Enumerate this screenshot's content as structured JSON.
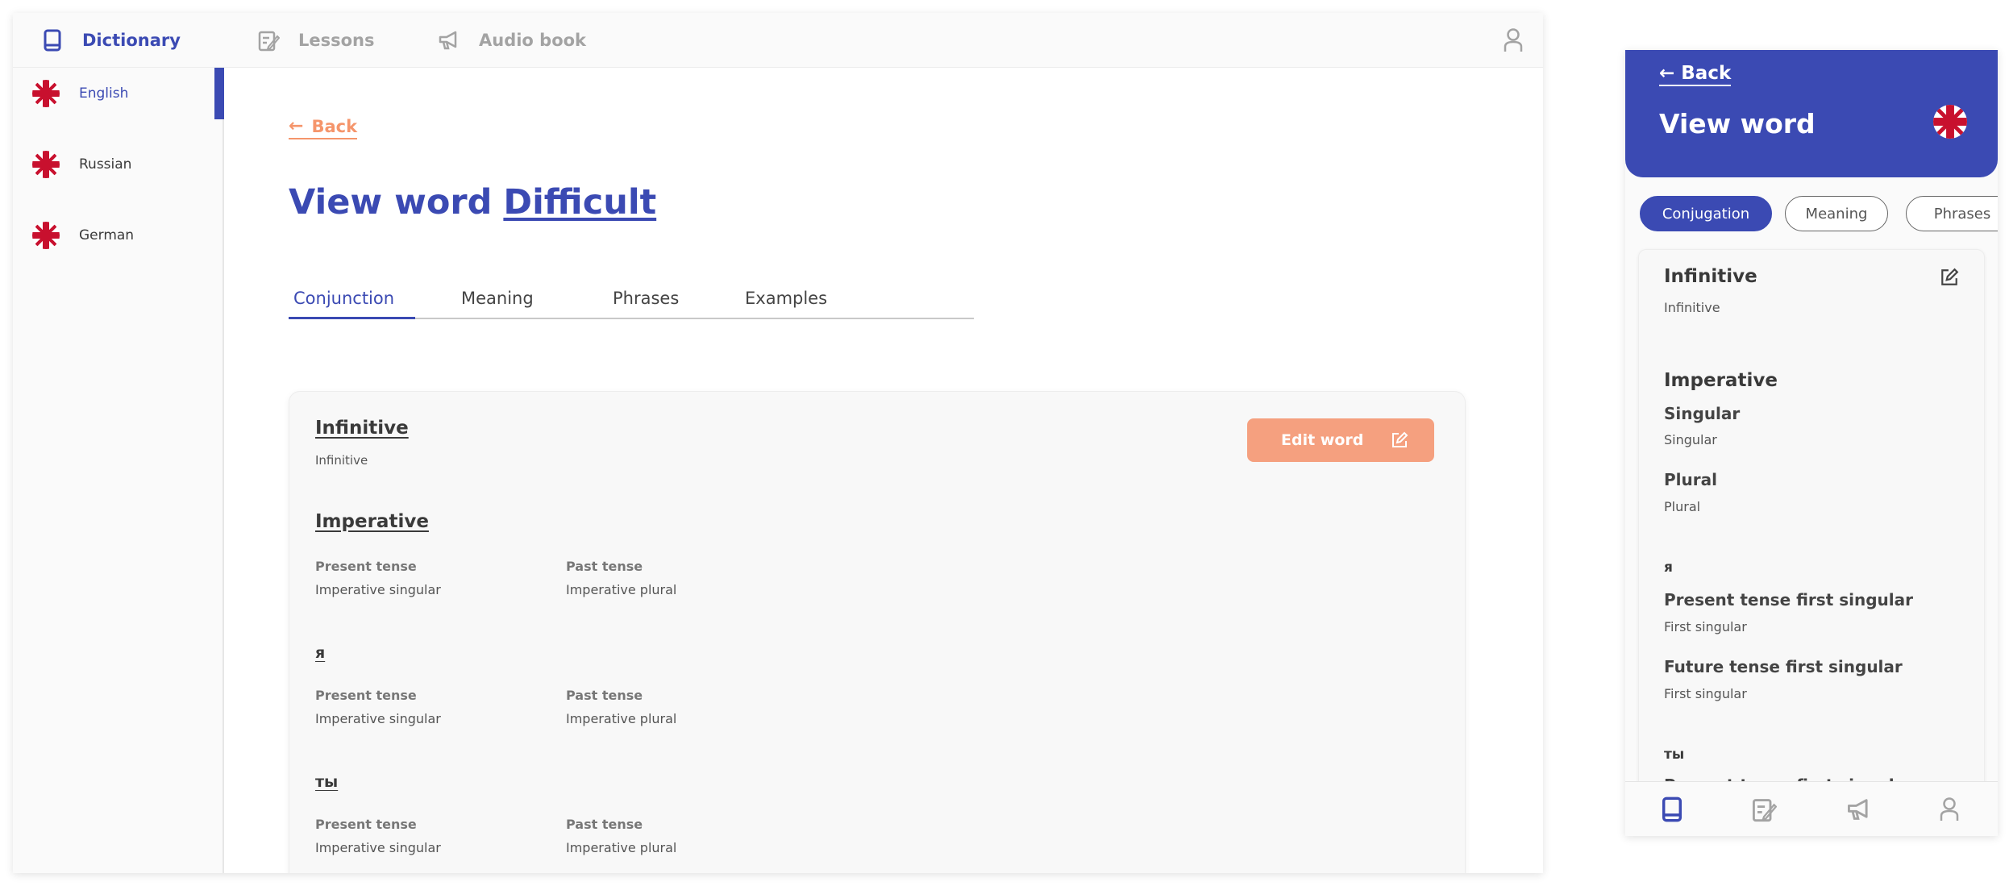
{
  "colors": {
    "primary": "#3b4ab3",
    "accent": "#f5956b",
    "button": "#f5a07f",
    "muted": "#a3a3a3"
  },
  "topnav": {
    "items": [
      {
        "label": "Dictionary",
        "icon": "book-icon",
        "active": true
      },
      {
        "label": "Lessons",
        "icon": "edit-note-icon",
        "active": false
      },
      {
        "label": "Audio book",
        "icon": "megaphone-icon",
        "active": false
      }
    ],
    "user_icon": "user-icon"
  },
  "sidebar": {
    "items": [
      {
        "label": "English",
        "icon": "uk-flag-icon",
        "active": true
      },
      {
        "label": "Russian",
        "icon": "uk-flag-icon",
        "active": false
      },
      {
        "label": "German",
        "icon": "uk-flag-icon",
        "active": false
      }
    ]
  },
  "main": {
    "back_label": "Back",
    "title_prefix": "View word",
    "title_word": "Difficult",
    "tabs": [
      {
        "label": "Conjunction",
        "active": true
      },
      {
        "label": "Meaning",
        "active": false
      },
      {
        "label": "Phrases",
        "active": false
      },
      {
        "label": "Examples",
        "active": false
      }
    ],
    "edit_button_label": "Edit word",
    "card": {
      "infinitive": {
        "title": "Infinitive",
        "value": "Infinitive"
      },
      "sections": [
        {
          "title": "Imperative",
          "col1_label": "Present tense",
          "col1_value": "Imperative singular",
          "col2_label": "Past tense",
          "col2_value": "Imperative plural"
        },
        {
          "title": "я",
          "col1_label": "Present tense",
          "col1_value": "Imperative singular",
          "col2_label": "Past tense",
          "col2_value": "Imperative plural"
        },
        {
          "title": "ты",
          "col1_label": "Present tense",
          "col1_value": "Imperative singular",
          "col2_label": "Past tense",
          "col2_value": "Imperative plural"
        }
      ]
    }
  },
  "mobile": {
    "back_label": "Back",
    "title": "View word",
    "chips": [
      {
        "label": "Conjugation",
        "active": true
      },
      {
        "label": "Meaning",
        "active": false
      },
      {
        "label": "Phrases",
        "active": false
      }
    ],
    "card": {
      "infinitive_title": "Infinitive",
      "infinitive_value": "Infinitive",
      "imperative_title": "Imperative",
      "singular_label": "Singular",
      "singular_value": "Singular",
      "plural_label": "Plural",
      "plural_value": "Plural",
      "pronoun_1": "я",
      "present_first_label": "Present tense first singular",
      "present_first_value": "First singular",
      "future_first_label": "Future tense first singular",
      "future_first_value": "First singular",
      "pronoun_2": "ты",
      "cut_label": "Present tense first singular"
    },
    "bottom_nav": [
      "book-icon",
      "edit-note-icon",
      "megaphone-icon",
      "user-icon"
    ]
  }
}
